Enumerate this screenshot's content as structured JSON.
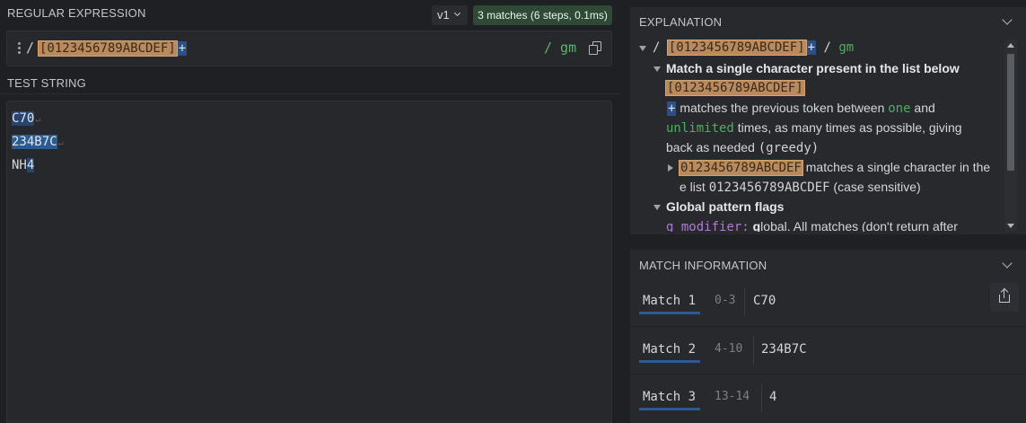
{
  "regex_section": {
    "title": "REGULAR EXPRESSION",
    "flavor": "v1",
    "match_summary": "3 matches (6 steps, 0.1ms)",
    "open_delim": "/",
    "char_class": "[0123456789ABCDEF]",
    "quantifier": "+",
    "flags": "/ gm"
  },
  "test_section": {
    "title": "TEST STRING",
    "lines": [
      {
        "text": "C70",
        "eol": "↵"
      },
      {
        "text": "234B7C",
        "eol": "↵"
      },
      {
        "pre": "NH",
        "hl": "4"
      }
    ]
  },
  "explanation": {
    "title": "EXPLANATION",
    "root": {
      "open": "/",
      "char_class": "[0123456789ABCDEF]",
      "quantifier": "+",
      "close": "/",
      "flags": "gm"
    },
    "node1": {
      "heading": "Match a single character present in the list below",
      "char_class": "[0123456789ABCDEF]",
      "plus": "+",
      "line2a": " matches the previous token between ",
      "one": "one",
      "and": " and",
      "unlimited": "unlimited",
      "line3": " times, as many times as possible, giving",
      "line4a": "back as needed ",
      "greedy": "(greedy)",
      "sub_token": "0123456789ABCDEF",
      "sub_text1": " matches a single character in the",
      "sub_text2a": "e list ",
      "sub_mono": "0123456789ABCDEF",
      "sub_text2b": " (case sensitive)"
    },
    "node2": {
      "heading": "Global pattern flags",
      "modifier": "g modifier:",
      "g": "g",
      "text": "lobal. All matches (don't return after"
    }
  },
  "match_info": {
    "title": "MATCH INFORMATION",
    "matches": [
      {
        "label": "Match 1",
        "range": "0-3",
        "value": "C70"
      },
      {
        "label": "Match 2",
        "range": "4-10",
        "value": "234B7C"
      },
      {
        "label": "Match 3",
        "range": "13-14",
        "value": "4"
      }
    ]
  }
}
